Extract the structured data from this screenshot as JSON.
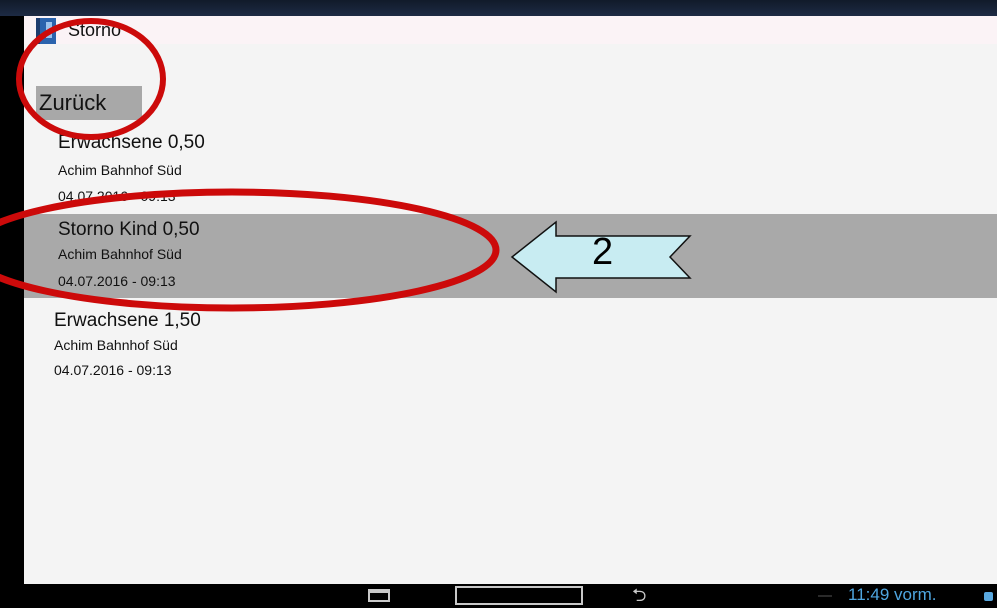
{
  "window": {
    "title": "Storno",
    "app_icon": "app-icon"
  },
  "back_button": {
    "label": "Zurück"
  },
  "tickets": [
    {
      "type": "Erwachsene 0,50",
      "station": "Achim Bahnhof Süd",
      "datetime": "04.07.2016 - 09:13",
      "selected": false
    },
    {
      "type": "Storno Kind 0,50",
      "station": "Achim Bahnhof Süd",
      "datetime": "04.07.2016 - 09:13",
      "selected": true
    },
    {
      "type": "Erwachsene 1,50",
      "station": "Achim Bahnhof Süd",
      "datetime": "04.07.2016 - 09:13",
      "selected": false
    }
  ],
  "annotation": {
    "arrow_label": "2",
    "circle_color": "#cc0a0a",
    "arrow_fill": "#c8ecf2"
  },
  "nav_bar": {
    "clock": "11:49 vorm.",
    "icons": [
      "recent-apps-icon",
      "home-button",
      "back-icon"
    ]
  },
  "colors": {
    "selected_row": "#a9a9a9",
    "background": "#f4f4f4",
    "clock": "#4fa6e0"
  }
}
